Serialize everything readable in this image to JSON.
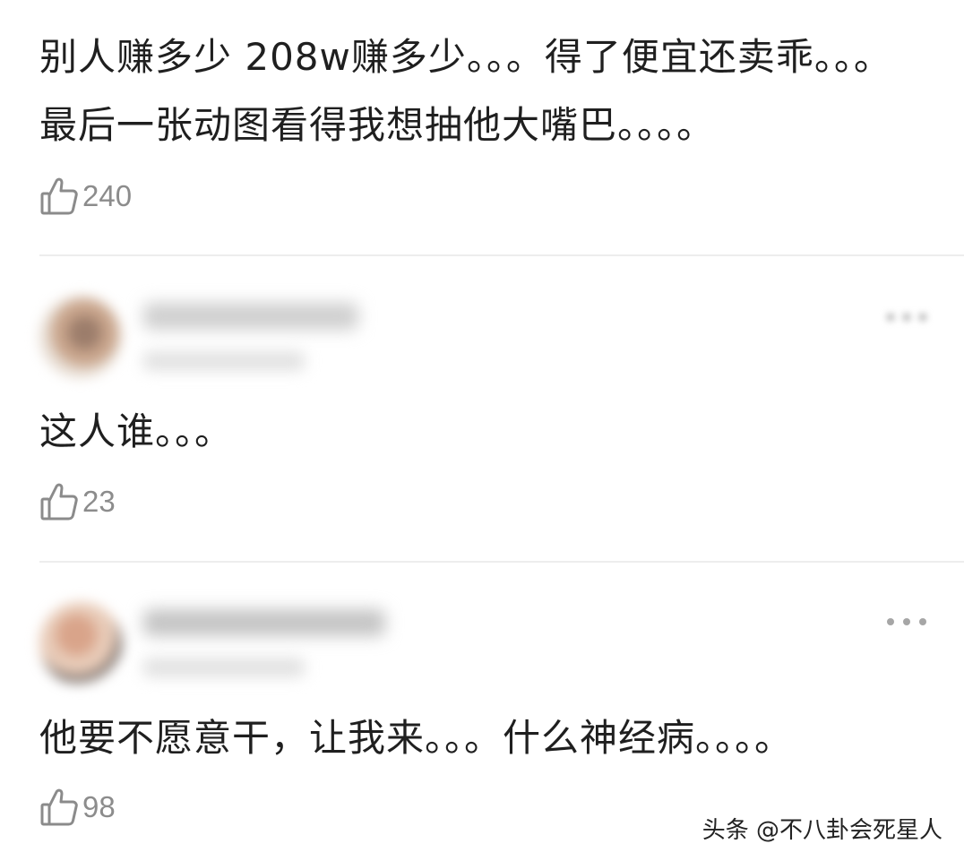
{
  "comments": [
    {
      "text": "别人赚多少 208w赚多少。。。得了便宜还卖乖。。。最后一张动图看得我想抽他大嘴巴。。。。",
      "likes": "240"
    },
    {
      "text": "这人谁。。。",
      "likes": "23"
    },
    {
      "text": "他要不愿意干，让我来。。。什么神经病。。。。",
      "likes": "98"
    }
  ],
  "icons": {
    "like": "thumbs-up-outline-icon",
    "more": "more-dots-icon"
  },
  "colors": {
    "text": "#1f1f1f",
    "meta": "#8c8c8c",
    "divider": "#ededed"
  },
  "watermark": "头条 @不八卦会死星人"
}
